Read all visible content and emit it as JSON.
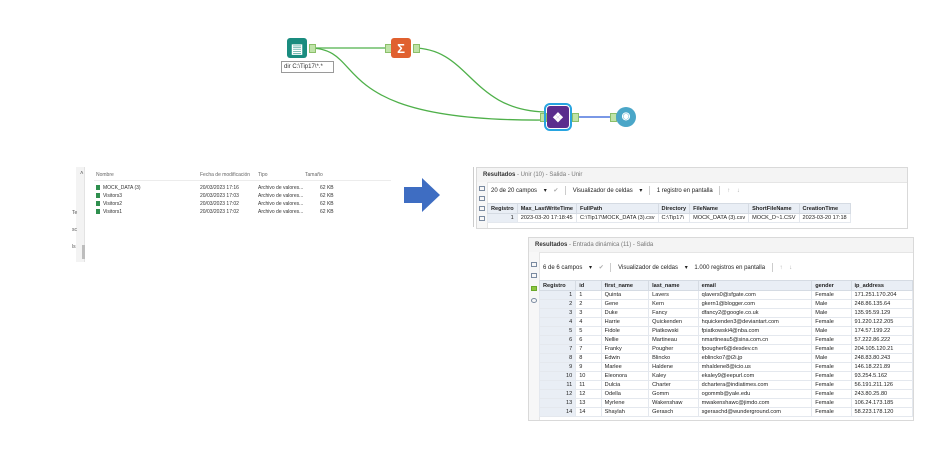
{
  "workflow": {
    "annotation": "dir C:\\Tip17\\*.*",
    "tools": [
      {
        "name": "directory-tool",
        "icon": "book-icon",
        "color": "#1a8c7f"
      },
      {
        "name": "summarize-tool",
        "icon": "sigma-icon",
        "color": "#e0602f"
      },
      {
        "name": "union-tool",
        "icon": "union-icon",
        "color": "#5b2d8e"
      },
      {
        "name": "browse-tool",
        "icon": "browse-icon",
        "color": "#4aa6c8"
      }
    ],
    "wire_color": "#4fb04a"
  },
  "explorer": {
    "headers": [
      "Nombre",
      "Fecha de modificación",
      "Tipo",
      "Tamaño"
    ],
    "left_labels": [
      "Te",
      "sc",
      "ls"
    ],
    "files": [
      {
        "name": "MOCK_DATA (3)",
        "date": "20/03/2023 17:16",
        "type": "Archivo de valores...",
        "size": "62 KB"
      },
      {
        "name": "Visitors3",
        "date": "20/03/2023 17:03",
        "type": "Archivo de valores...",
        "size": "62 KB"
      },
      {
        "name": "Visitors2",
        "date": "20/03/2023 17:02",
        "type": "Archivo de valores...",
        "size": "62 KB"
      },
      {
        "name": "Visitors1",
        "date": "20/03/2023 17:02",
        "type": "Archivo de valores...",
        "size": "62 KB"
      }
    ]
  },
  "arrow_color": "#3e6dc2",
  "results1": {
    "title": "Resultados",
    "subtitle": " - Unir (10) - Salida - Unir",
    "fields": "20 de 20 campos",
    "viewer": "Visualizador de celdas",
    "records": "1 registro en pantalla",
    "columns": [
      "Registro",
      "Max_LastWriteTime",
      "FullPath",
      "Directory",
      "FileName",
      "ShortFileName",
      "CreationTime"
    ],
    "rows": [
      [
        "1",
        "2023-03-20 17:18:45",
        "C:\\Tip17\\MOCK_DATA (3).csv",
        "C:\\Tip17\\",
        "MOCK_DATA (3).csv",
        "MOCK_D~1.CSV",
        "2023-03-20 17:18"
      ]
    ]
  },
  "results2": {
    "title": "Resultados",
    "subtitle": " - Entrada dinámica (11) - Salida",
    "fields": "6 de 6 campos",
    "viewer": "Visualizador de celdas",
    "records": "1.000 registros en pantalla",
    "columns": [
      "Registro",
      "id",
      "first_name",
      "last_name",
      "email",
      "gender",
      "ip_address"
    ],
    "rows": [
      [
        "1",
        "1",
        "Quinta",
        "Lavers",
        "qlavers0@sfgate.com",
        "Female",
        "171.251.170.204"
      ],
      [
        "2",
        "2",
        "Gene",
        "Kern",
        "gkern1@blogger.com",
        "Male",
        "248.86.135.64"
      ],
      [
        "3",
        "3",
        "Duke",
        "Fancy",
        "dfancy2@google.co.uk",
        "Male",
        "135.95.59.129"
      ],
      [
        "4",
        "4",
        "Harrie",
        "Quickenden",
        "hquickenden3@deviantart.com",
        "Female",
        "91.220.122.205"
      ],
      [
        "5",
        "5",
        "Fidole",
        "Piatkowski",
        "fpiatkowski4@nba.com",
        "Male",
        "174.57.199.22"
      ],
      [
        "6",
        "6",
        "Nellie",
        "Martineau",
        "nmartineau5@sina.com.cn",
        "Female",
        "57.222.86.222"
      ],
      [
        "7",
        "7",
        "Franky",
        "Pougher",
        "fpougher6@desdev.cn",
        "Female",
        "204.105.120.21"
      ],
      [
        "8",
        "8",
        "Edwin",
        "Blincko",
        "eblincko7@i2i.jp",
        "Male",
        "248.83.80.243"
      ],
      [
        "9",
        "9",
        "Marlee",
        "Haldene",
        "mhaldene8@icio.us",
        "Female",
        "146.18.221.89"
      ],
      [
        "10",
        "10",
        "Eleonora",
        "Kaley",
        "ekaley9@eepurl.com",
        "Female",
        "93.254.5.162"
      ],
      [
        "11",
        "11",
        "Dulcia",
        "Charter",
        "dcharterа@indiatimes.com",
        "Female",
        "56.191.211.126"
      ],
      [
        "12",
        "12",
        "Odella",
        "Gomm",
        "ogommb@yale.edu",
        "Female",
        "243.80.25.80"
      ],
      [
        "13",
        "13",
        "Myrlene",
        "Wakenshaw",
        "mwakenshawc@jimdo.com",
        "Female",
        "106.24.173.185"
      ],
      [
        "14",
        "14",
        "Shaylah",
        "Gerasch",
        "sgeraschd@wunderground.com",
        "Female",
        "58.223.178.120"
      ]
    ]
  }
}
